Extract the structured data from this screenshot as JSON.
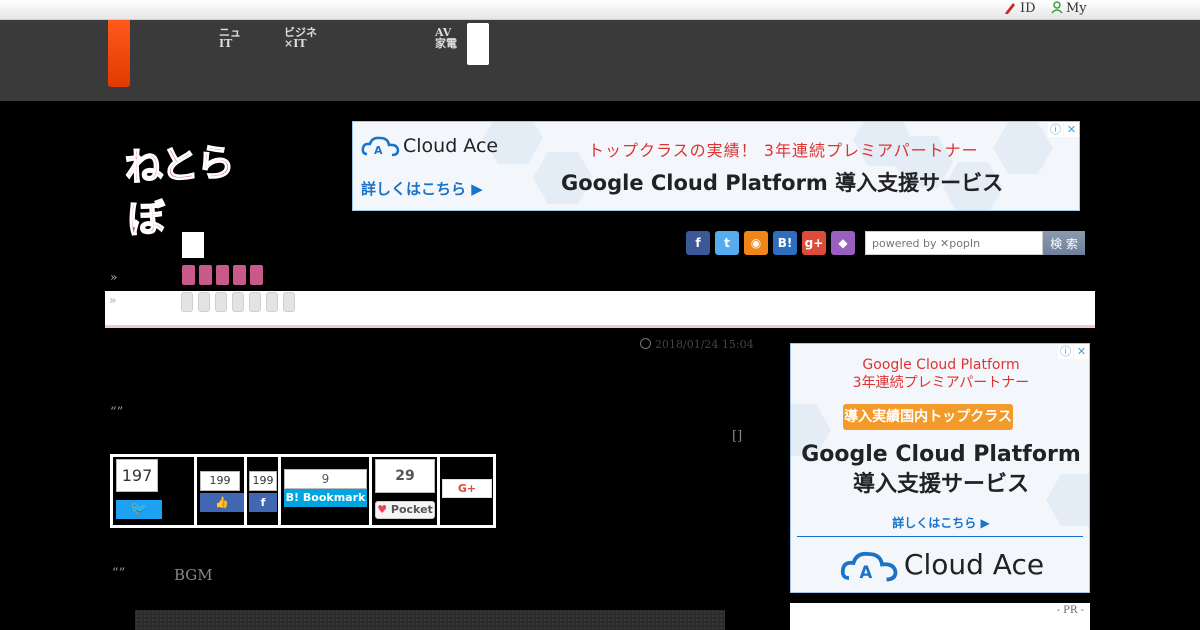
{
  "topbar": {
    "id_label": "ID",
    "my_label": "My"
  },
  "nav": {
    "item1": "ニュ\nIT",
    "item2": "ビジネ\n×IT",
    "item3": "AV\n家電"
  },
  "logo": {
    "text": "ねとらぼ"
  },
  "ad_top": {
    "brand": "Cloud Ace",
    "headline": "トップクラスの実績！ 3年連続プレミアパートナー",
    "product": "Google Cloud Platform 導入支援サービス",
    "cta": "詳しくはこちら ▶",
    "info_icon": "info-icon",
    "close_icon": "close-icon"
  },
  "social": [
    {
      "name": "facebook-icon",
      "glyph": "f",
      "color": "#3b5998"
    },
    {
      "name": "twitter-icon",
      "glyph": "t",
      "color": "#55acee"
    },
    {
      "name": "rss-icon",
      "glyph": "◉",
      "color": "#f0861a"
    },
    {
      "name": "hatena-icon",
      "glyph": "B!",
      "color": "#2c6ebd"
    },
    {
      "name": "google-plus-icon",
      "glyph": "g+",
      "color": "#dd4b39"
    },
    {
      "name": "cat-icon",
      "glyph": "◆",
      "color": "#9b5fc0"
    }
  ],
  "search": {
    "placeholder": "powered by ✕popIn",
    "button": "検 索"
  },
  "breadcrumb": {
    "sep": "»"
  },
  "article": {
    "date": "2018/01/24 15:04",
    "quote1": "“”",
    "bracket": "[]",
    "quote2": "“”",
    "bgm": "BGM"
  },
  "share": {
    "twitter_count": "197",
    "like_count": "199",
    "fb_count": "199",
    "hatena_count": "9",
    "hatena_label": "B! Bookmark",
    "pocket_count": "29",
    "pocket_label": "Pocket",
    "gplus_label": "G+"
  },
  "ad_side": {
    "t1": "Google Cloud Platform\n3年連続プレミアパートナー",
    "pill": "導入実績国内トップクラス",
    "t2": "Google Cloud Platform\n導入支援サービス",
    "cta": "詳しくはこちら ▶",
    "brand": "Cloud Ace"
  },
  "pr": {
    "label": "- PR -"
  }
}
